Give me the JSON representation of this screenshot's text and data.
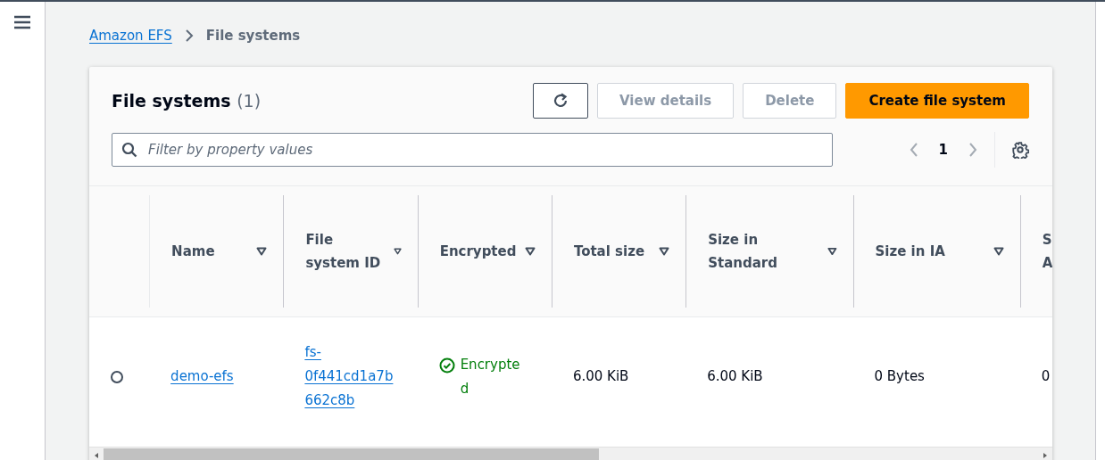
{
  "breadcrumbs": [
    {
      "label": "Amazon EFS",
      "kind": "link"
    },
    {
      "label": "File systems",
      "kind": "current"
    }
  ],
  "panel": {
    "title": "File systems",
    "count": "(1)",
    "actions": [
      {
        "kind": "refresh"
      },
      {
        "kind": "normal",
        "label": "View details",
        "disabled": true
      },
      {
        "kind": "normal",
        "label": "Delete",
        "disabled": true
      },
      {
        "kind": "primary",
        "label": "Create file system",
        "disabled": false
      }
    ],
    "filter": {
      "placeholder": "Filter by property values"
    },
    "pagination": {
      "page": "1",
      "prev_disabled": true,
      "next_disabled": true
    }
  },
  "table": {
    "columns": [
      "Name",
      "File system ID",
      "Encrypted",
      "Total size",
      "Size in Standard",
      "Size in IA",
      "S A"
    ],
    "rows": [
      {
        "selected": false,
        "name": "demo-efs",
        "file_system_id": "fs-0f441cd1a7b662c8b",
        "encrypted": "Encrypted",
        "total_size": "6.00 KiB",
        "size_standard": "6.00 KiB",
        "size_ia": "0 Bytes",
        "column_7": "0"
      }
    ]
  }
}
